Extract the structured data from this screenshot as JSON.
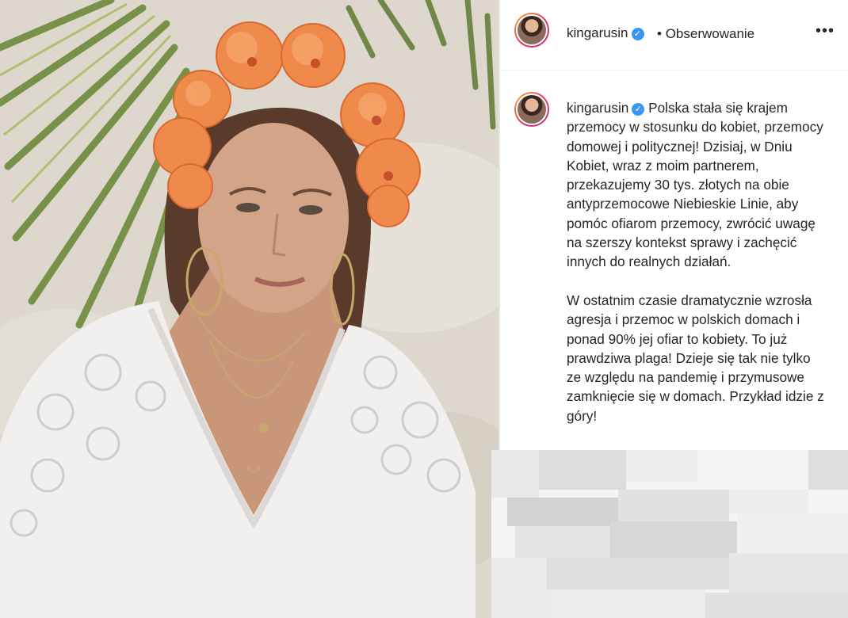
{
  "header": {
    "username": "kingarusin",
    "verified": true,
    "separator": "•",
    "follow_label": "Obserwowanie",
    "more_icon": "more-horizontal-icon"
  },
  "post": {
    "username": "kingarusin",
    "verified": true,
    "caption": "Polska stała się krajem przemocy w stosunku do kobiet, przemocy domowej i politycznej! Dzisiaj, w Dniu Kobiet, wraz z moim partnerem, przekazujemy 30 tys. złotych na obie antyprzemocowe Niebieskie Linie, aby pomóc ofiarom przemocy, zwrócić uwagę na szerszy kontekst sprawy i zachęcić innych do realnych działań.\n\nW ostatnim czasie dramatycznie wzrosła agresja i przemoc w polskich domach i ponad 90% jej ofiar to kobiety. To już prawdziwa plaga! Dzieje się tak nie tylko ze względu na pandemię i przymusowe zamknięcie się w domach. Przykład idzie z góry!"
  },
  "colors": {
    "verified_badge": "#3897f0",
    "text": "#262626",
    "divider": "#efefef",
    "flower": "#f08a4b"
  }
}
